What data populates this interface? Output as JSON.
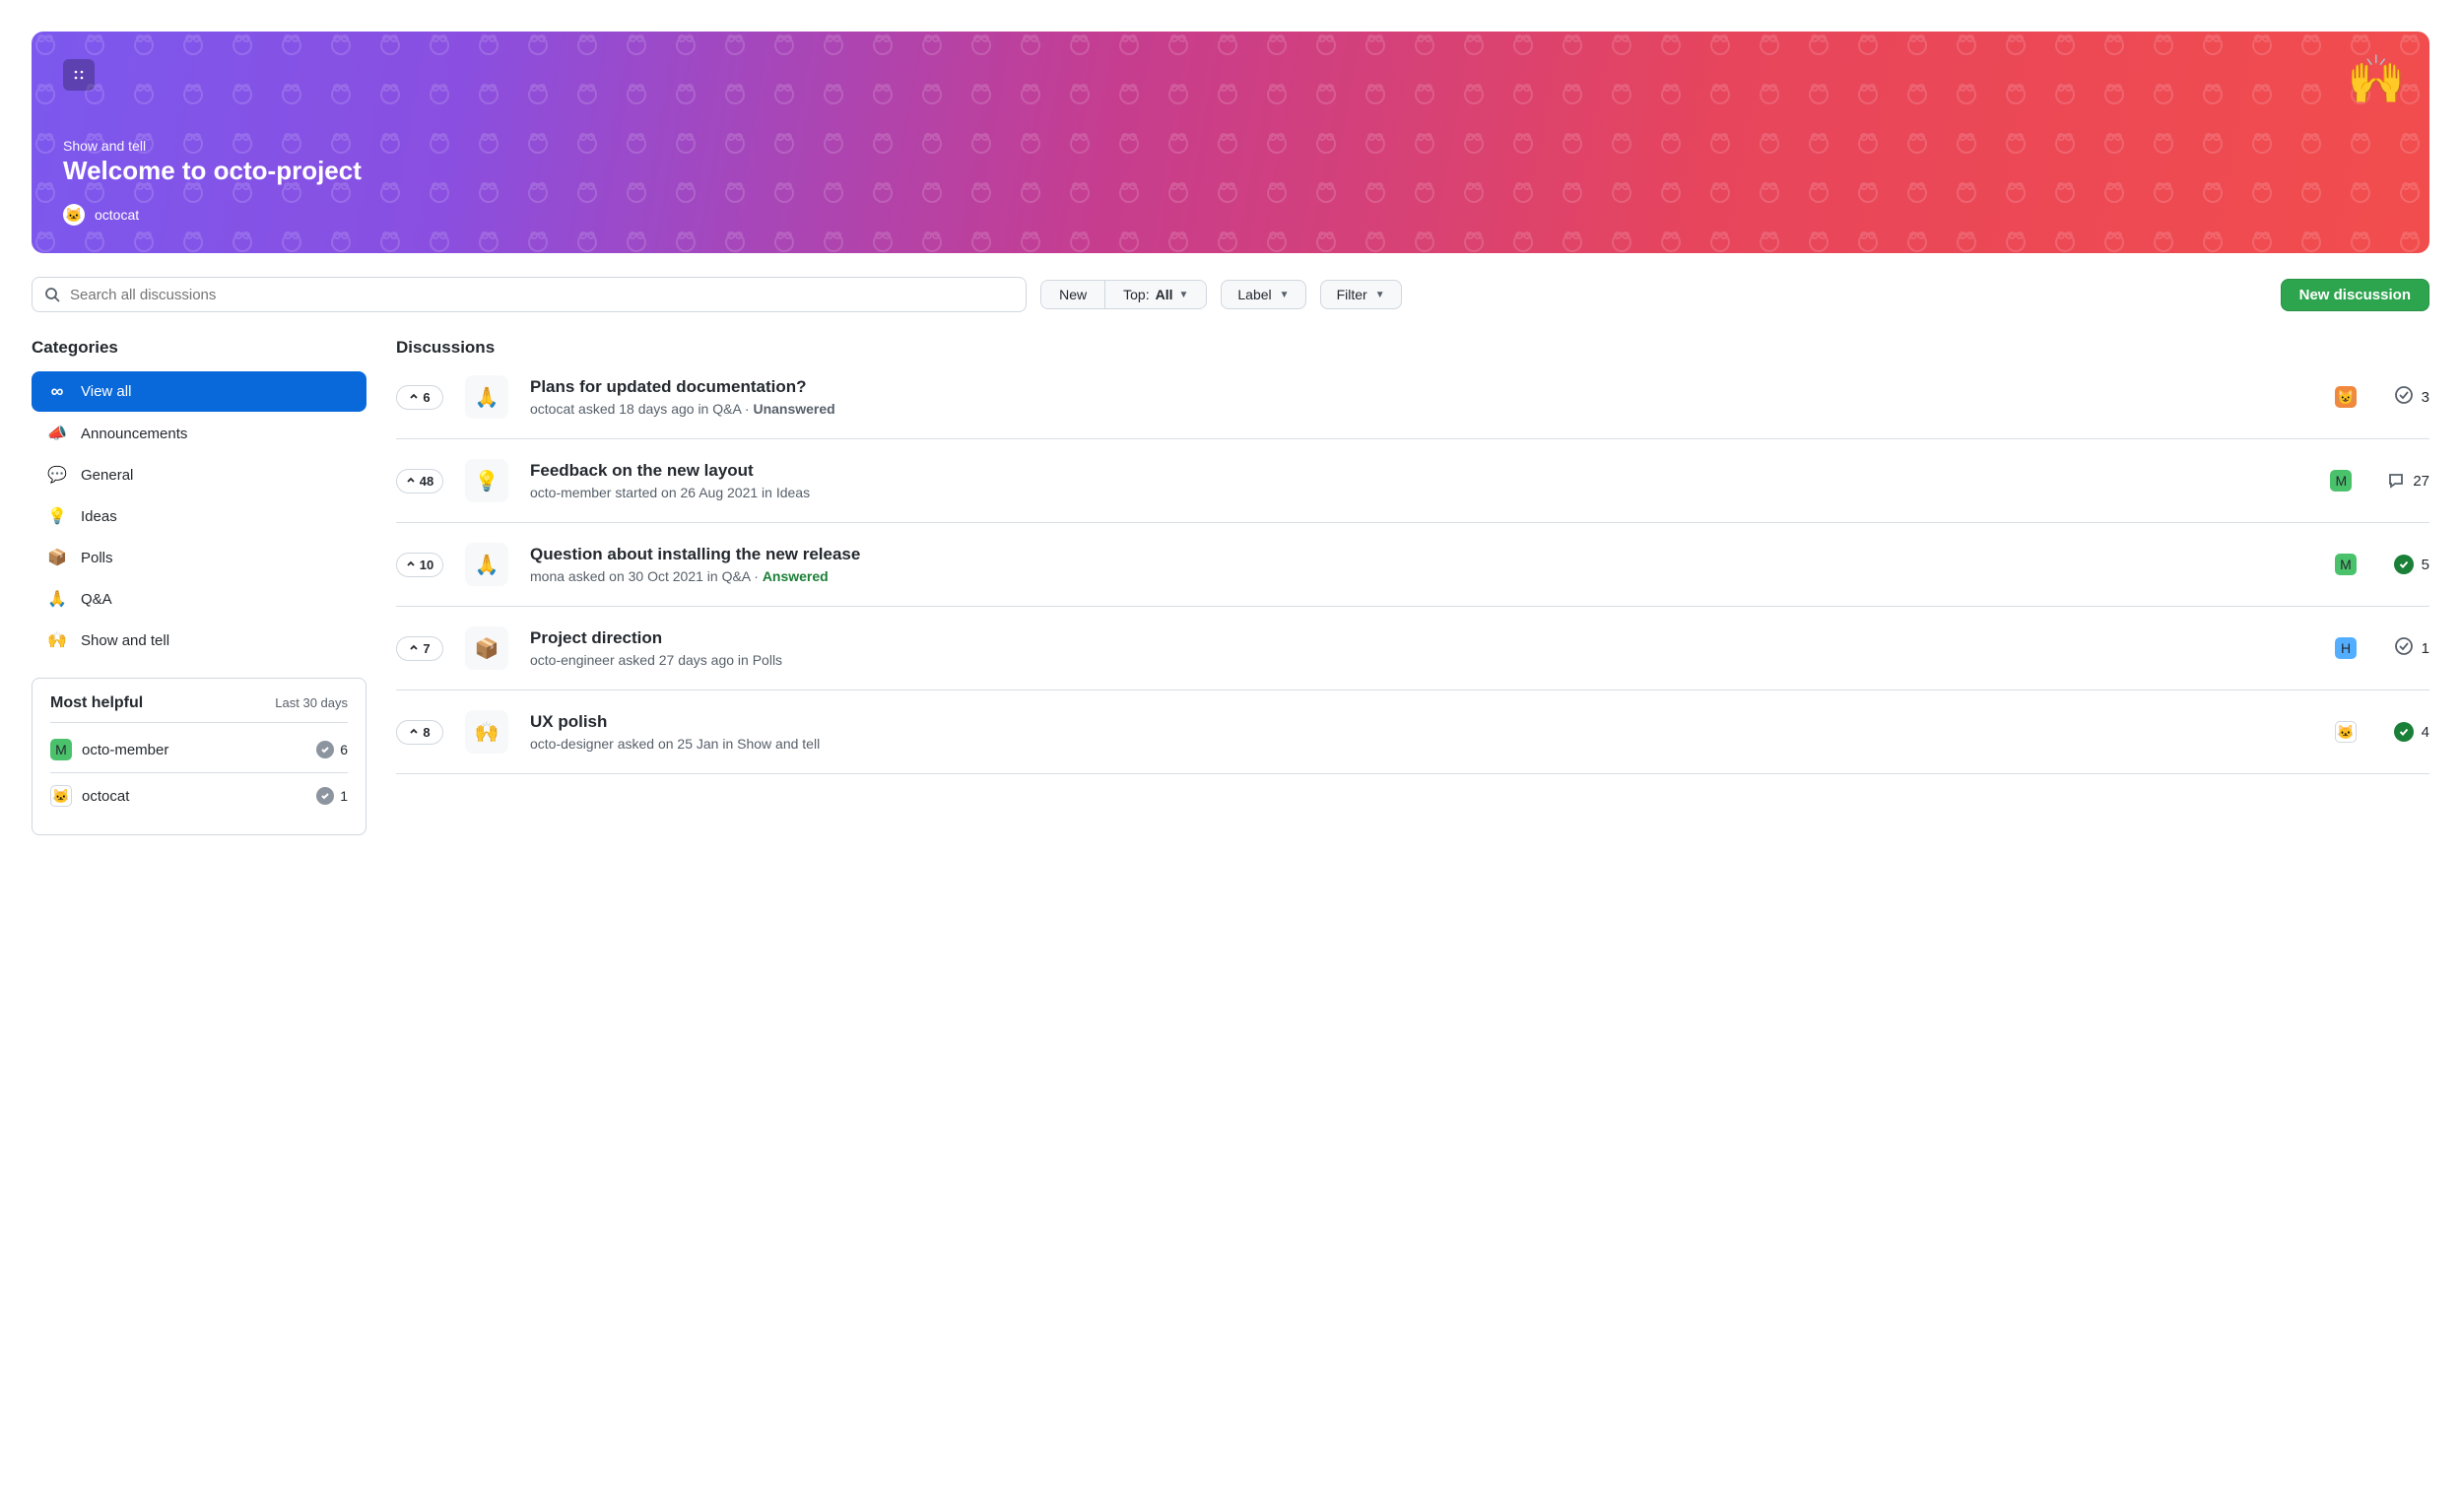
{
  "banner": {
    "category": "Show and tell",
    "title": "Welcome to octo-project",
    "author": "octocat",
    "emoji": "🙌"
  },
  "toolbar": {
    "search_placeholder": "Search all discussions",
    "new_label": "New",
    "top_prefix": "Top: ",
    "top_value": "All",
    "label_label": "Label",
    "filter_label": "Filter",
    "new_discussion_label": "New discussion"
  },
  "sidebar": {
    "categories_title": "Categories",
    "categories": [
      {
        "icon": "∞",
        "label": "View all",
        "active": true,
        "icon_is_unicode": true
      },
      {
        "icon": "📣",
        "label": "Announcements"
      },
      {
        "icon": "💬",
        "label": "General"
      },
      {
        "icon": "💡",
        "label": "Ideas"
      },
      {
        "icon": "📦",
        "label": "Polls"
      },
      {
        "icon": "🙏",
        "label": "Q&A"
      },
      {
        "icon": "🙌",
        "label": "Show and tell"
      }
    ],
    "helpful": {
      "title": "Most helpful",
      "subtitle": "Last 30 days",
      "users": [
        {
          "name": "octo-member",
          "count": 6,
          "avatar_color": "green",
          "avatar_glyph": "M"
        },
        {
          "name": "octocat",
          "count": 1,
          "avatar_color": "white",
          "avatar_glyph": "🐱"
        }
      ]
    }
  },
  "discussions": {
    "title": "Discussions",
    "items": [
      {
        "upvotes": 6,
        "icon": "🙏",
        "title": "Plans for updated documentation?",
        "meta_prefix": "octocat asked 18 days ago in Q&A · ",
        "status": "Unanswered",
        "status_kind": "unanswered",
        "participant": {
          "color": "orange",
          "glyph": "😺"
        },
        "comment_icon": "check-outline",
        "comments": 3
      },
      {
        "upvotes": 48,
        "icon": "💡",
        "title": "Feedback on the new layout",
        "meta_prefix": "octo-member started on 26 Aug 2021 in Ideas",
        "status": "",
        "status_kind": "",
        "participant": {
          "color": "green",
          "glyph": "M"
        },
        "comment_icon": "bubble",
        "comments": 27
      },
      {
        "upvotes": 10,
        "icon": "🙏",
        "title": "Question about installing the new release",
        "meta_prefix": "mona asked on 30 Oct 2021 in Q&A · ",
        "status": "Answered",
        "status_kind": "answered",
        "participant": {
          "color": "green",
          "glyph": "M"
        },
        "comment_icon": "check-filled",
        "comments": 5
      },
      {
        "upvotes": 7,
        "icon": "📦",
        "title": "Project direction",
        "meta_prefix": "octo-engineer asked 27 days ago in Polls",
        "status": "",
        "status_kind": "",
        "participant": {
          "color": "blue",
          "glyph": "H"
        },
        "comment_icon": "check-outline",
        "comments": 1
      },
      {
        "upvotes": 8,
        "icon": "🙌",
        "title": "UX polish",
        "meta_prefix": "octo-designer asked on 25 Jan in Show and tell",
        "status": "",
        "status_kind": "",
        "participant": {
          "color": "white",
          "glyph": "🐱"
        },
        "comment_icon": "check-filled",
        "comments": 4
      }
    ]
  }
}
